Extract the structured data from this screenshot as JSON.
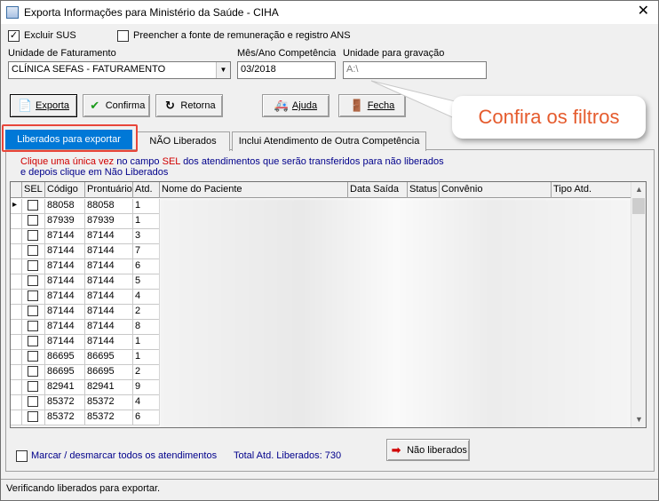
{
  "window": {
    "title": "Exporta Informações para Ministério da Saúde - CIHA",
    "close": "✕"
  },
  "options": {
    "excluir_sus": {
      "label": "Excluir SUS",
      "checked": true
    },
    "preencher": {
      "label": "Preencher a fonte de remuneração e registro ANS",
      "checked": false
    }
  },
  "filters": {
    "unidade_fat_label": "Unidade de Faturamento",
    "unidade_fat_value": "CLÍNICA SEFAS - FATURAMENTO",
    "competencia_label": "Mês/Ano Competência",
    "competencia_value": "03/2018",
    "gravacao_label": "Unidade para gravação",
    "gravacao_value": "A:\\"
  },
  "toolbar": {
    "exporta": "Exporta",
    "confirma": "Confirma",
    "retorna": "Retorna",
    "ajuda": "Ajuda",
    "fecha": "Fecha"
  },
  "callout": "Confira os filtros",
  "tabs": [
    "Liberados para exportar",
    "NÃO Liberados",
    "Inclui Atendimento de Outra Competência"
  ],
  "instructions": {
    "line1_a": "Clique uma única vez",
    "line1_b": "no campo",
    "line1_c": "SEL",
    "line1_d": "dos atendimentos que serão transferidos para não liberados",
    "line2": "e depois clique em Não Liberados"
  },
  "grid": {
    "columns": [
      "SEL",
      "Código",
      "Prontuário",
      "Atd.",
      "Nome do Paciente",
      "Data Saída",
      "Status",
      "Convênio",
      "Tipo Atd."
    ],
    "rows": [
      {
        "codigo": "88058",
        "prontuario": "88058",
        "atd": "1"
      },
      {
        "codigo": "87939",
        "prontuario": "87939",
        "atd": "1"
      },
      {
        "codigo": "87144",
        "prontuario": "87144",
        "atd": "3"
      },
      {
        "codigo": "87144",
        "prontuario": "87144",
        "atd": "7"
      },
      {
        "codigo": "87144",
        "prontuario": "87144",
        "atd": "6"
      },
      {
        "codigo": "87144",
        "prontuario": "87144",
        "atd": "5"
      },
      {
        "codigo": "87144",
        "prontuario": "87144",
        "atd": "4"
      },
      {
        "codigo": "87144",
        "prontuario": "87144",
        "atd": "2"
      },
      {
        "codigo": "87144",
        "prontuario": "87144",
        "atd": "8"
      },
      {
        "codigo": "87144",
        "prontuario": "87144",
        "atd": "1"
      },
      {
        "codigo": "86695",
        "prontuario": "86695",
        "atd": "1"
      },
      {
        "codigo": "86695",
        "prontuario": "86695",
        "atd": "2"
      },
      {
        "codigo": "82941",
        "prontuario": "82941",
        "atd": "9"
      },
      {
        "codigo": "85372",
        "prontuario": "85372",
        "atd": "4"
      },
      {
        "codigo": "85372",
        "prontuario": "85372",
        "atd": "6"
      }
    ]
  },
  "footer": {
    "marcar": "Marcar / desmarcar todos os atendimentos",
    "total": "Total Atd. Liberados: 730",
    "nao_liberados_btn": "Não liberados"
  },
  "status": "Verificando liberados para exportar."
}
